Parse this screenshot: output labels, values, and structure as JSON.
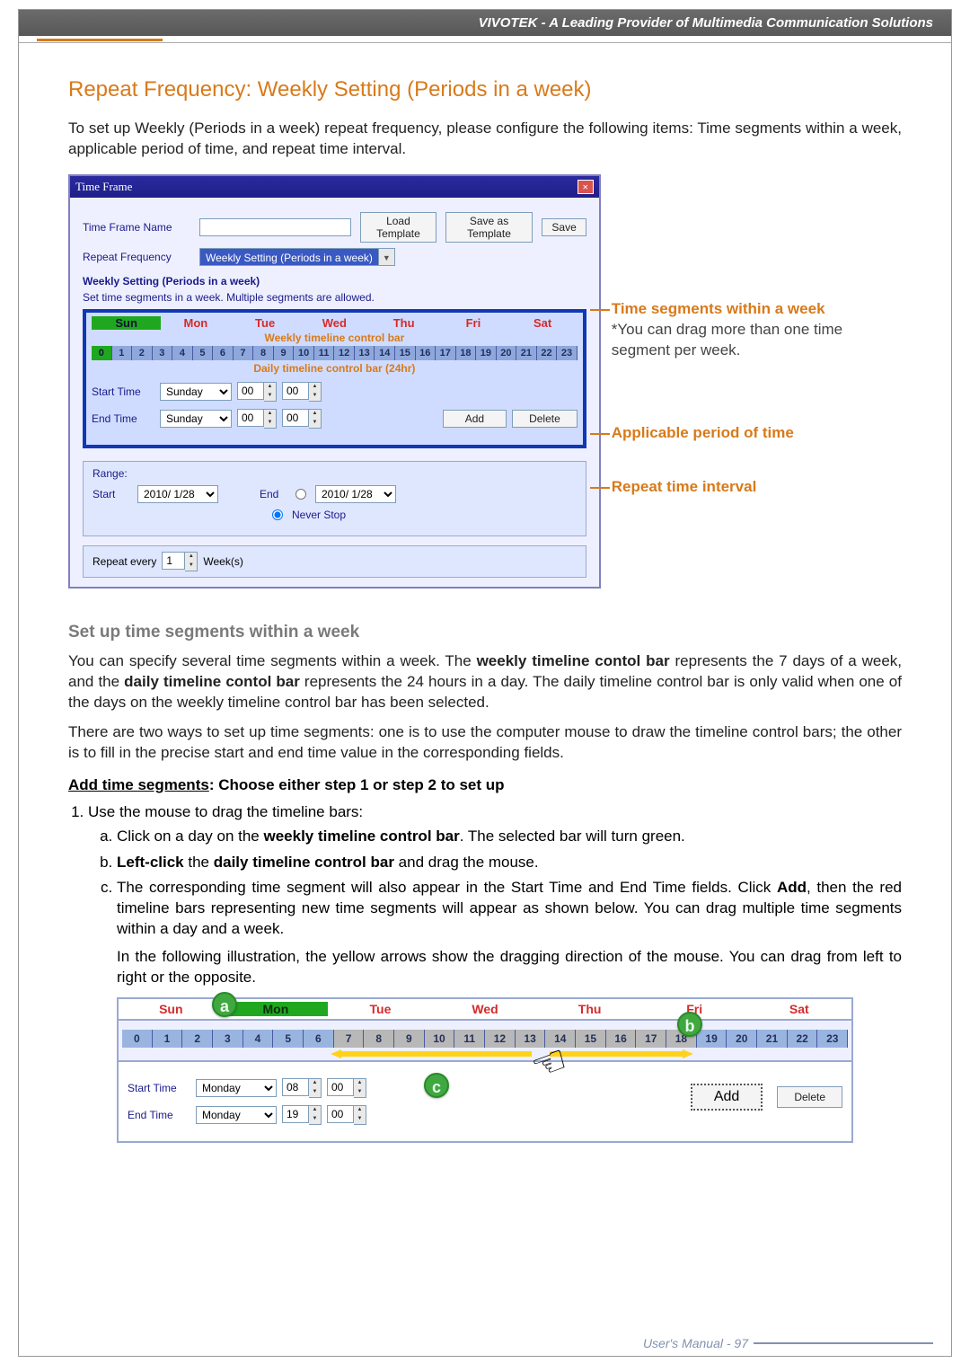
{
  "header": {
    "banner": "VIVOTEK - A Leading Provider of Multimedia Communication Solutions"
  },
  "section": {
    "title": "Repeat Frequency: Weekly Setting (Periods in a week)",
    "intro": "To set up Weekly (Periods in a week) repeat frequency, please configure the following items: Time segments within a week, applicable period of time, and repeat time interval."
  },
  "dialog": {
    "title": "Time Frame",
    "close": "×",
    "name_label": "Time Frame Name",
    "load_template": "Load Template",
    "save_template": "Save as Template",
    "save": "Save",
    "rf_label": "Repeat Frequency",
    "rf_value": "Weekly Setting (Periods in a week)",
    "section_title": "Weekly Setting (Periods in a week)",
    "hint": "Set time segments in a week. Multiple segments are allowed.",
    "days": [
      "Sun",
      "Mon",
      "Tue",
      "Wed",
      "Thu",
      "Fri",
      "Sat"
    ],
    "wk_bar_label": "Weekly timeline control bar",
    "hours": [
      "0",
      "1",
      "2",
      "3",
      "4",
      "5",
      "6",
      "7",
      "8",
      "9",
      "10",
      "11",
      "12",
      "13",
      "14",
      "15",
      "16",
      "17",
      "18",
      "19",
      "20",
      "21",
      "22",
      "23"
    ],
    "daily_bar_label": "Daily timeline control bar (24hr)",
    "start_time": "Start Time",
    "end_time": "End Time",
    "day_value": "Sunday",
    "hour_value": "00",
    "min_value": "00",
    "add": "Add",
    "delete": "Delete",
    "range_label": "Range:",
    "start": "Start",
    "end": "End",
    "date": "2010/ 1/28",
    "never_stop": "Never Stop",
    "repeat_every": "Repeat every",
    "repeat_n": "1",
    "repeat_unit": "Week(s)"
  },
  "annot": {
    "a1_head": "Time segments within a week",
    "a1_body": "*You can drag more than one time segment per week.",
    "a2_head": "Applicable period of time",
    "a3_head": "Repeat time interval"
  },
  "setup": {
    "title": "Set up time segments within a week",
    "p1_a": "You can specify several time segments within a week. The ",
    "p1_b": "weekly timeline contol bar",
    "p1_c": " represents the 7 days of a week, and the ",
    "p1_d": "daily timeline contol bar",
    "p1_e": " represents the 24 hours in a day. The daily timeline control bar is only valid when one of the days on the weekly timeline control bar has been selected.",
    "p2": "There are two ways to set up time segments: one is to use the computer mouse to draw the timeline control bars; the other is to fill in the precise start and end time value in the corresponding fields.",
    "add_head": "Add time segments",
    "add_tail": ": Choose either step 1 or step 2 to set up",
    "s1": "Use the mouse to drag the timeline bars:",
    "s1a_a": "Click on a day on the ",
    "s1a_b": "weekly timeline control bar",
    "s1a_c": ". The selected bar will turn green.",
    "s1b_a": "Left-click",
    "s1b_b": " the ",
    "s1b_c": "daily timeline control bar",
    "s1b_d": " and drag the mouse.",
    "s1c_a": "The corresponding time segment will also appear in the Start Time and End Time fields. Click ",
    "s1c_b": "Add",
    "s1c_c": ", then the red timeline bars representing new time segments will appear as shown below. You can drag multiple time segments within a day and a week.",
    "s1c_d": "In the following illustration, the yellow arrows show the dragging direction of the mouse. You can drag from left to right or the opposite."
  },
  "illus": {
    "days": [
      "Sun",
      "Mon",
      "Tue",
      "Wed",
      "Thu",
      "Fri",
      "Sat"
    ],
    "hours": [
      "0",
      "1",
      "2",
      "3",
      "4",
      "5",
      "6",
      "7",
      "8",
      "9",
      "10",
      "11",
      "12",
      "13",
      "14",
      "15",
      "16",
      "17",
      "18",
      "19",
      "20",
      "21",
      "22",
      "23"
    ],
    "start_time": "Start Time",
    "end_time": "End Time",
    "day_value": "Monday",
    "st_h": "08",
    "st_m": "00",
    "et_h": "19",
    "et_m": "00",
    "add": "Add",
    "delete": "Delete",
    "badge_a": "a",
    "badge_b": "b",
    "badge_c": "c"
  },
  "footer": {
    "text": "User's Manual - 97"
  }
}
